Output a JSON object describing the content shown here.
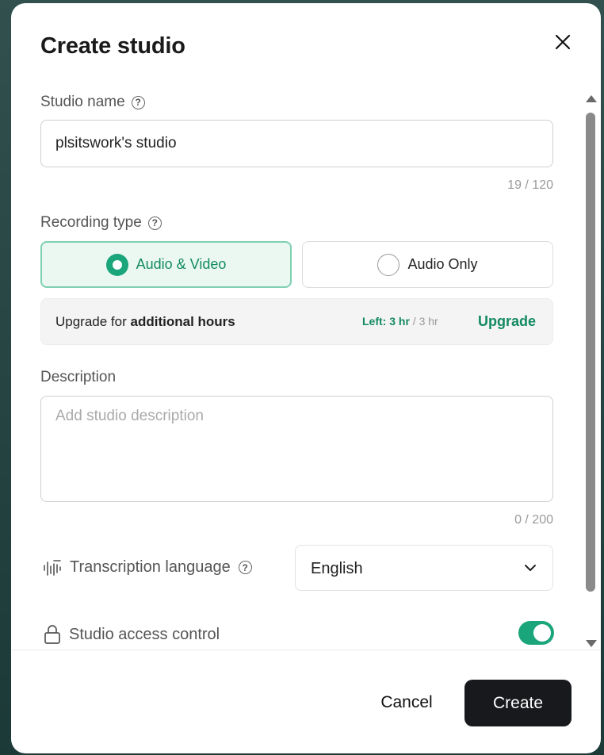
{
  "dialog": {
    "title": "Create studio",
    "close_icon": "close-icon"
  },
  "studio_name": {
    "label": "Studio name",
    "value": "plsitswork's studio",
    "counter": "19 / 120"
  },
  "recording_type": {
    "label": "Recording type",
    "options": [
      {
        "label": "Audio & Video",
        "selected": true
      },
      {
        "label": "Audio Only",
        "selected": false
      }
    ]
  },
  "upgrade": {
    "text_prefix": "Upgrade for",
    "text_bold": "additional hours",
    "left_label": "Left:",
    "left_value": "3 hr",
    "total": "/ 3 hr",
    "link": "Upgrade"
  },
  "description": {
    "label": "Description",
    "placeholder": "Add studio description",
    "counter": "0 / 200"
  },
  "transcription": {
    "label": "Transcription language",
    "selected": "English",
    "icon": "waveform-icon"
  },
  "access_control": {
    "label": "Studio access control",
    "enabled": true,
    "icon": "lock-icon"
  },
  "footer": {
    "cancel": "Cancel",
    "create": "Create"
  },
  "colors": {
    "accent": "#1aa57a",
    "primary_button": "#17191c"
  }
}
